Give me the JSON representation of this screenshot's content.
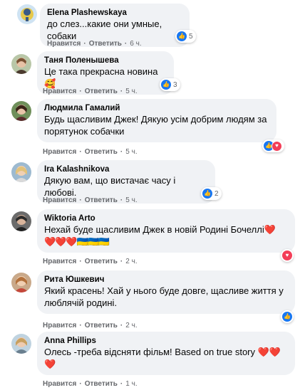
{
  "labels": {
    "like": "Нравится",
    "reply": "Ответить",
    "dot": "·"
  },
  "colors": {
    "bubble": "#f0f2f5",
    "like": "#1877f2",
    "love": "#f33e58",
    "meta": "#65676b"
  },
  "comments": [
    {
      "author": "Elena Plashewskaya",
      "text": "до слез...какие они умные, собаки",
      "time": "6 ч.",
      "reactions": [
        "like"
      ],
      "count": "5"
    },
    {
      "author": "Таня Поленышева",
      "text": "Це така прекрасна новина 🥰",
      "time": "5 ч.",
      "reactions": [
        "like"
      ],
      "count": "3"
    },
    {
      "author": "Людмила Гамалий",
      "text": "Будь щасливим Джек! Дякую усім добрим людям за порятунок собачки",
      "time": "5 ч.",
      "reactions": [
        "like",
        "love"
      ],
      "count": ""
    },
    {
      "author": "Ira Kalashnikova",
      "text": "Дякую вам, що вистачає часу і любові.",
      "time": "5 ч.",
      "reactions": [
        "like"
      ],
      "count": "2"
    },
    {
      "author": "Wiktoria Arto",
      "text": "Нехай буде щасливим Джек в новій Родині Бочеллі❤️",
      "emojis": "❤️❤️❤️🇺🇦🇺🇦🇺🇦",
      "time": "2 ч.",
      "reactions": [
        "love"
      ],
      "count": ""
    },
    {
      "author": "Рита Юшкевич",
      "text": "Який красень! Хай у нього буде довге, щасливе життя у люблячій родині.",
      "time": "2 ч.",
      "reactions": [
        "like"
      ],
      "count": ""
    },
    {
      "author": "Anna Phillips",
      "text": "Олесь -треба відсняти фільм! Based on true story ❤️❤️",
      "emojis": "❤️",
      "time": "1 ч.",
      "reactions": [],
      "count": ""
    }
  ]
}
